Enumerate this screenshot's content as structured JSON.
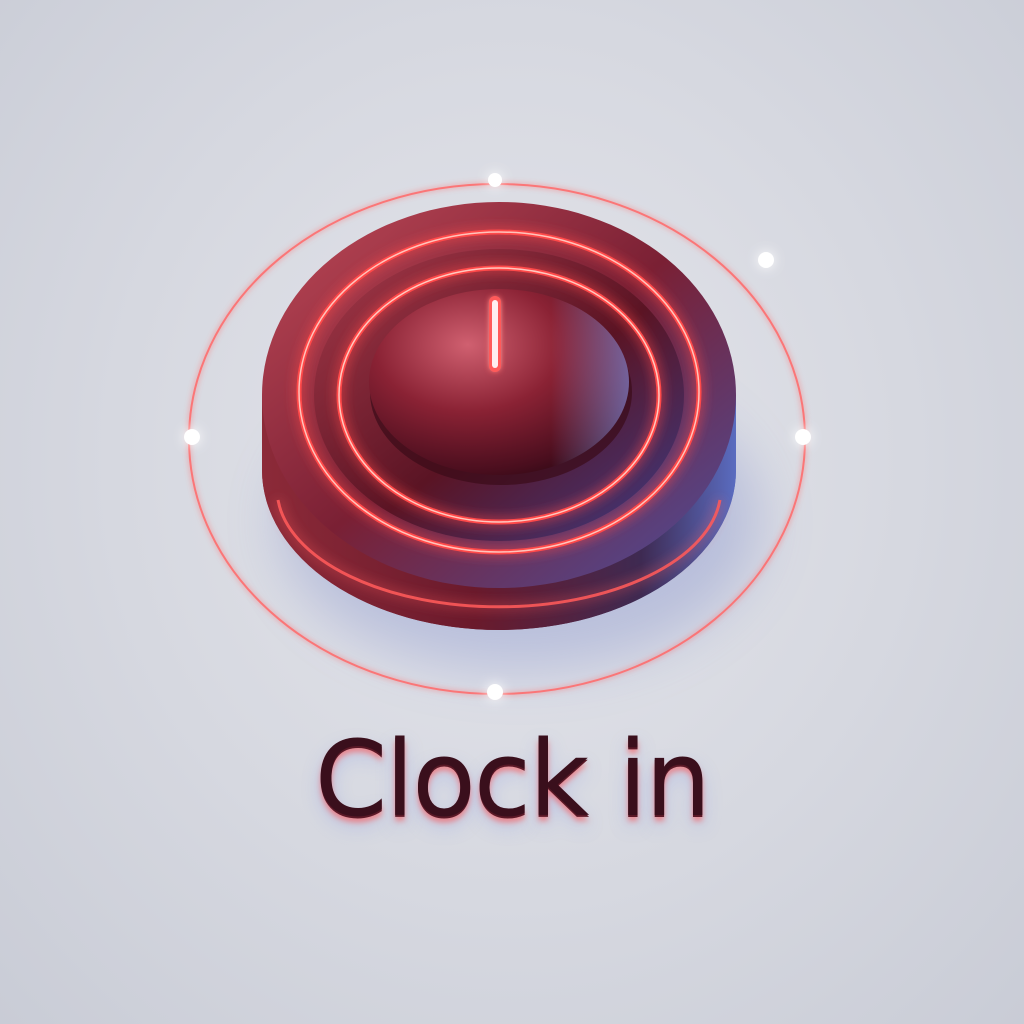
{
  "clock_button": {
    "label": "Clock in",
    "icon": "power-icon",
    "colors": {
      "glow": "#ff4a4a",
      "body_dark": "#4a1020",
      "body_light": "#b03040",
      "highlight": "#7f95e6",
      "text": "#3a0f1c"
    }
  }
}
